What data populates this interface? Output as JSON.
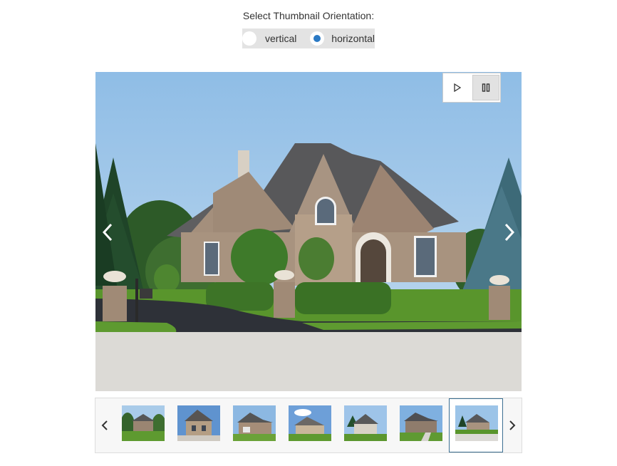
{
  "orientation": {
    "label": "Select Thumbnail Orientation:",
    "options": [
      {
        "label": "vertical",
        "checked": false
      },
      {
        "label": "horizontal",
        "checked": true
      }
    ],
    "accent_color": "#2a79c4"
  },
  "gallery": {
    "play_icon": "play-icon",
    "pause_icon": "pause-icon",
    "pause_active": true,
    "prev_icon": "chevron-left-icon",
    "next_icon": "chevron-right-icon"
  },
  "thumbnails": {
    "count": 7,
    "selected_index": 6,
    "prev_icon": "chevron-left-icon",
    "next_icon": "chevron-right-icon"
  }
}
